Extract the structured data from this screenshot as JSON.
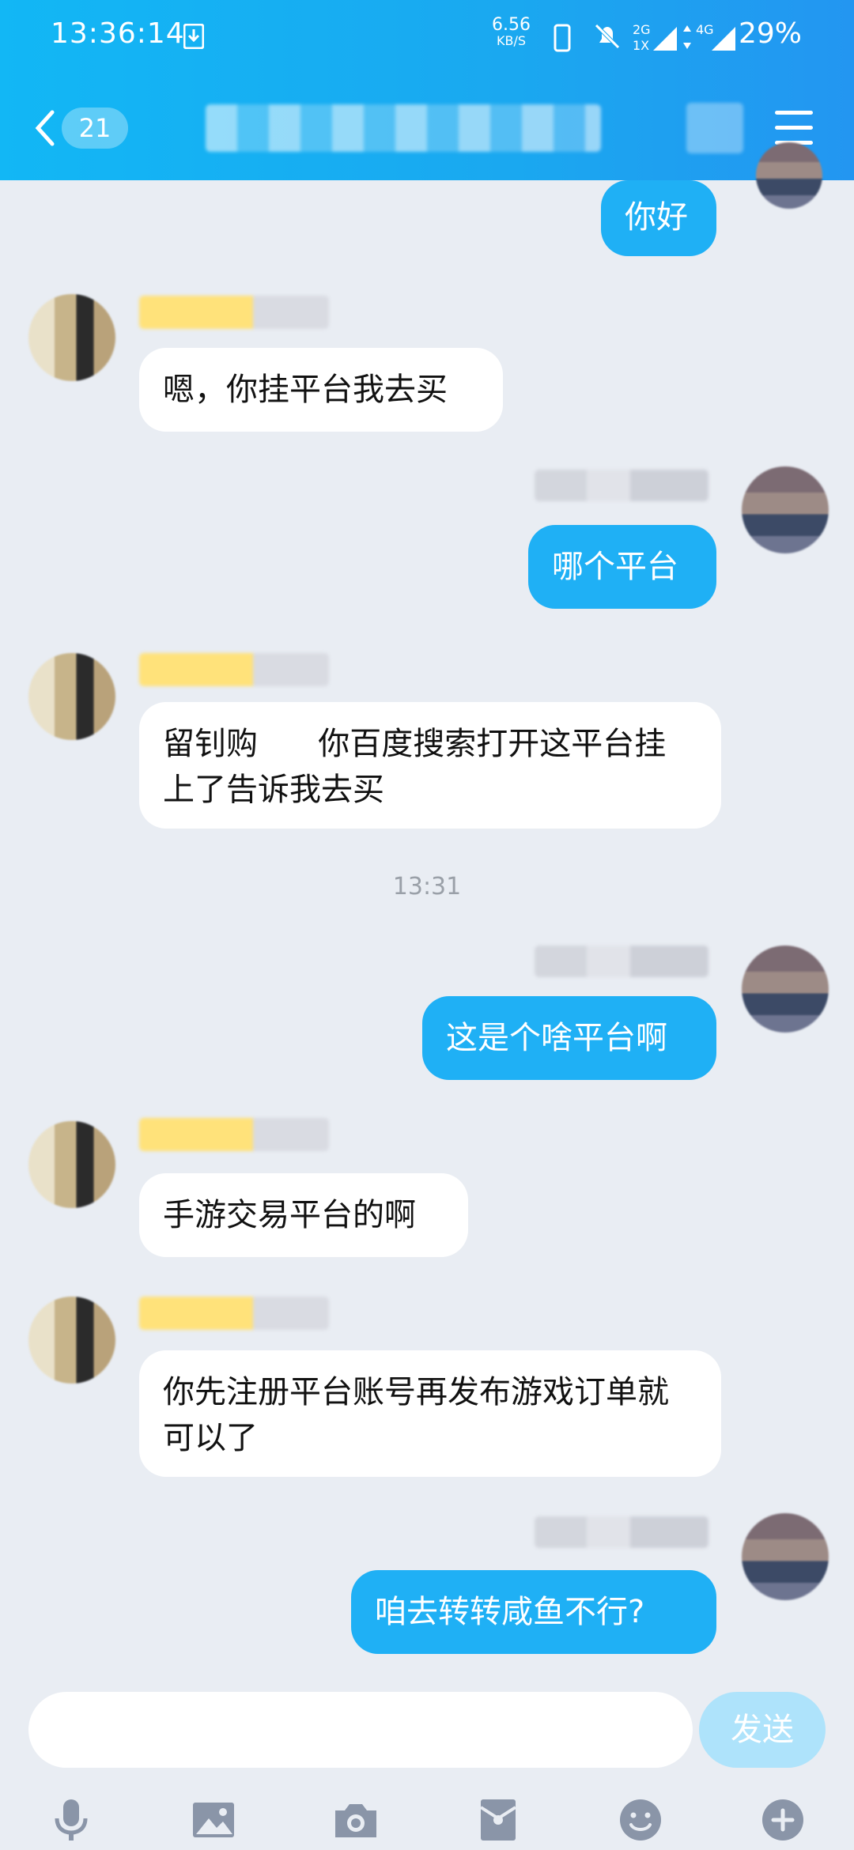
{
  "status_bar": {
    "time": "13:36:14",
    "net_speed": "6.56",
    "net_speed_unit": "KB/S",
    "sim1_label": "2G",
    "sim1_sub": "1X",
    "sim2_label": "4G",
    "battery": "29%"
  },
  "header": {
    "unread_count": "21"
  },
  "messages": [
    {
      "side": "right",
      "text": "你好"
    },
    {
      "side": "left",
      "text": "嗯，你挂平台我去买"
    },
    {
      "side": "right",
      "text": "哪个平台"
    },
    {
      "side": "left",
      "text": "留钊购      你百度搜索打开这平台挂上了告诉我去买"
    },
    {
      "side": "right",
      "text": "这是个啥平台啊"
    },
    {
      "side": "left",
      "text": "手游交易平台的啊"
    },
    {
      "side": "left",
      "text": "你先注册平台账号再发布游戏订单就可以了"
    },
    {
      "side": "right",
      "text": "咱去转转咸鱼不行?"
    }
  ],
  "timestamp": "13:31",
  "input": {
    "value": "",
    "send_label": "发送"
  },
  "toolbar_icons": [
    "microphone-icon",
    "image-icon",
    "camera-icon",
    "red-packet-icon",
    "emoji-icon",
    "plus-icon"
  ],
  "colors": {
    "header": "#12b7f5",
    "bubble_right": "#1fb0f5",
    "bubble_left": "#ffffff",
    "background": "#e9edf3",
    "send_disabled": "#aee3fb"
  }
}
